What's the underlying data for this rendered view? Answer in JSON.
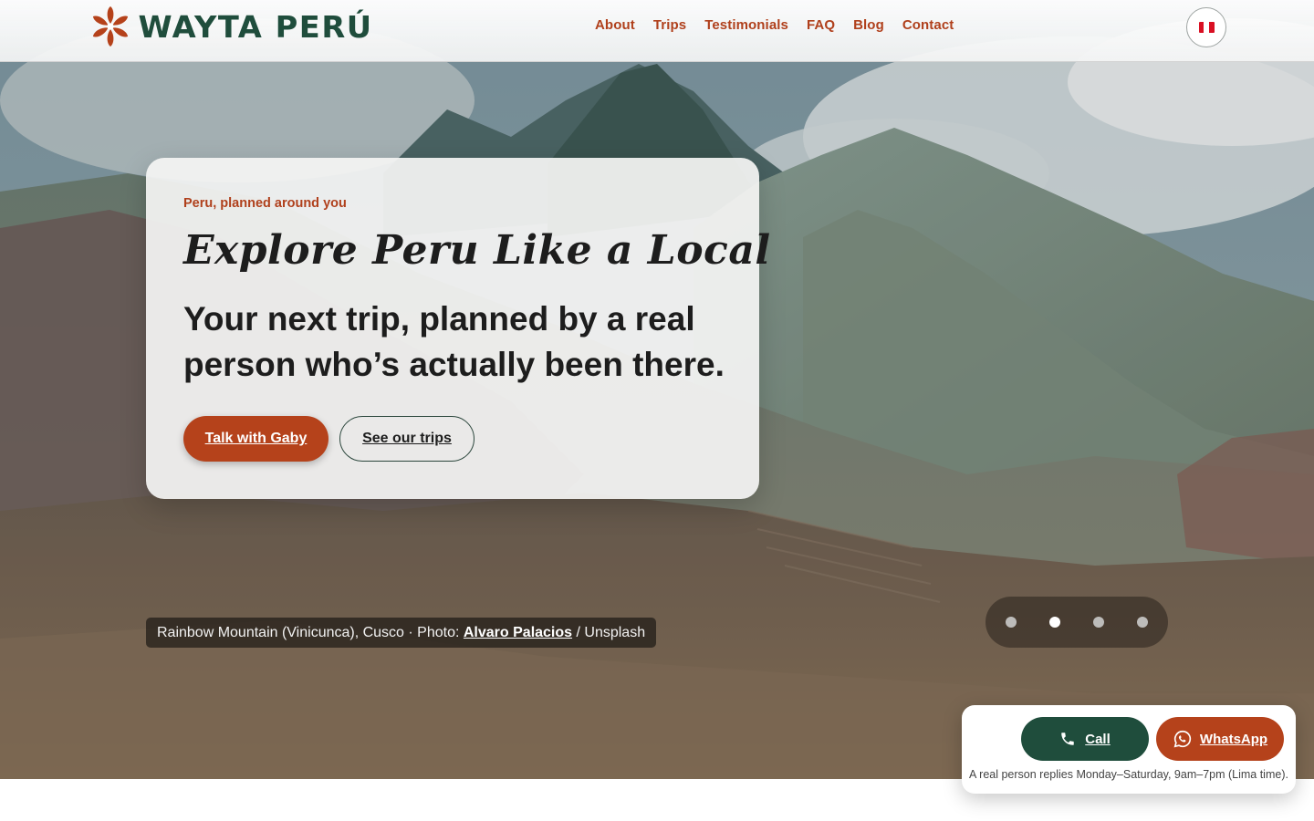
{
  "header": {
    "logo_text": "WAYTA PERÚ",
    "nav": [
      "About",
      "Trips",
      "Testimonials",
      "FAQ",
      "Blog",
      "Contact"
    ],
    "language_flag": "peru-flag-icon"
  },
  "hero": {
    "eyebrow": "Peru, planned around you",
    "title": "Explore Peru Like a Local",
    "subtitle": "Your next trip, planned by a real person who’s actually been there.",
    "primary_cta": "Talk with Gaby",
    "secondary_cta": "See our trips",
    "caption": {
      "prefix": "Rainbow Mountain (Vinicunca), Cusco · Photo: ",
      "author": "Alvaro Palacios",
      "suffix": " / Unsplash"
    },
    "slider": {
      "slides": 4,
      "active_slide": 2
    }
  },
  "contact_widget": {
    "call_label": "Call",
    "whatsapp_label": "WhatsApp",
    "note": "A real person replies Monday–Saturday, 9am–7pm (Lima time)."
  },
  "colors": {
    "brand_green": "#1f4d3c",
    "brand_rust": "#b5421b",
    "flag_red": "#d91023"
  }
}
